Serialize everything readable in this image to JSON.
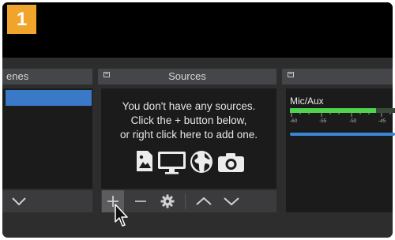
{
  "step_badge": "1",
  "docks": {
    "scenes": {
      "title": "enes"
    },
    "sources": {
      "title": "Sources",
      "empty_message": [
        "You don't have any sources.",
        "Click the + button below,",
        "or right click here to add one."
      ]
    },
    "mixer": {
      "channel_label": "Mic/Aux",
      "meter_ticks": [
        "-60",
        "-55",
        "-50",
        "-45"
      ],
      "meter_level": 0.82
    }
  },
  "icons": {
    "source_types": [
      "image-icon",
      "monitor-icon",
      "globe-icon",
      "camera-icon"
    ],
    "toolbar": [
      "chevron-down-icon",
      "plus-icon",
      "minus-icon",
      "gear-icon",
      "chevron-up-icon",
      "chevron-down-icon"
    ]
  },
  "colors": {
    "accent_badge": "#f0a42b",
    "selection": "#3a78c8",
    "meter_green": "#4fd34f",
    "volume_blue": "#3a86d6"
  }
}
